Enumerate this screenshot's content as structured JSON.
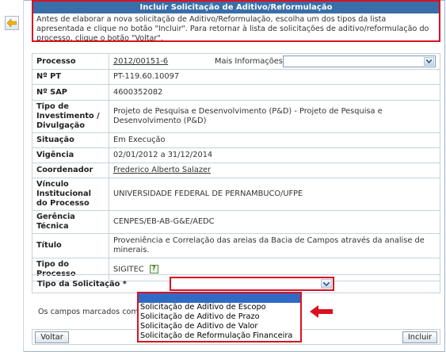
{
  "header": {
    "title": "Incluir Solicitação de Aditivo/Reformulação",
    "text": "Antes de elaborar a nova solicitação de Aditivo/Reformulação, escolha um dos tipos da lista apresentada e clique no botão \"Incluir\". Para retornar à lista de solicitações de aditivo/reformulação do processo, clique o botão \"Voltar\"."
  },
  "rows": [
    {
      "label": "Processo",
      "value": "2012/00151-6"
    },
    {
      "label": "Nº PT",
      "value": "PT-119.60.10097"
    },
    {
      "label": "Nº SAP",
      "value": "4600352082"
    },
    {
      "label": "Tipo de Investimento / Divulgação",
      "value": "Projeto de Pesquisa e Desenvolvimento (P&D) - Projeto de Pesquisa e Desenvolvimento (P&D)"
    },
    {
      "label": "Situação",
      "value": "Em Execução"
    },
    {
      "label": "Vigência",
      "value": "02/01/2012 a 31/12/2014"
    },
    {
      "label": "Coordenador",
      "value": "Frederico Alberto Salazer"
    },
    {
      "label": "Vínculo Institucional do Processo",
      "value": "UNIVERSIDADE FEDERAL DE PERNAMBUCO/UFPE"
    },
    {
      "label": "Gerência Técnica",
      "value": "CENPES/EB-AB-G&E/AEDC"
    },
    {
      "label": "Título",
      "value": "Proveniência e Correlação das areias da Bacia de Campos através da analise de minerais."
    },
    {
      "label": "Tipo do Processo",
      "value": "SIGITEC"
    }
  ],
  "mais_info": {
    "label": "Mais Informações",
    "value": ""
  },
  "help_icon": "?",
  "tipo_solicitacao": {
    "label": "Tipo da Solicitação *",
    "value": "",
    "options": [
      "",
      "Solicitação de Aditivo de Escopo",
      "Solicitação de Aditivo de Prazo",
      "Solicitação de Aditivo de Valor",
      "Solicitação de Reformulação Financeira"
    ]
  },
  "note": "Os campos marcados com *",
  "buttons": {
    "voltar": "Voltar",
    "incluir": "Incluir"
  },
  "colors": {
    "accent_red": "#d9121f",
    "header_blue": "#3a6ea8",
    "selected_blue": "#316ac5"
  },
  "icons": {
    "back": "back-arrow-icon",
    "dropdown": "chevron-down-icon",
    "help": "help-icon",
    "annotation": "red-arrow-icon"
  }
}
